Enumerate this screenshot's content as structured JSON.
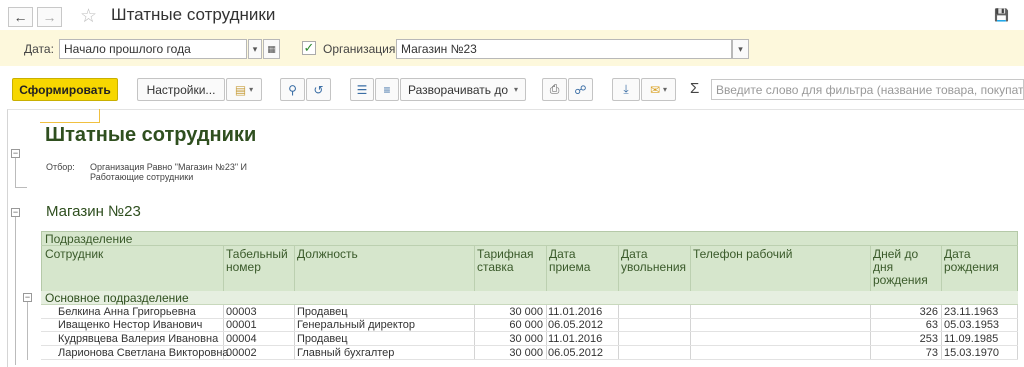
{
  "window": {
    "title": "Штатные сотрудники"
  },
  "params": {
    "date_label": "Дата:",
    "date_value": "Начало прошлого года",
    "org_label": "Организация:",
    "org_value": "Магазин №23"
  },
  "toolbar": {
    "generate_label": "Сформировать",
    "settings_label": "Настройки...",
    "expand_label": "Разворачивать до",
    "filter_placeholder": "Введите слово для фильтра (название товара, покупателя...)"
  },
  "report": {
    "title": "Штатные сотрудники",
    "filter_label": "Отбор:",
    "filter_text_line1": "Организация Равно \"Магазин №23\" И",
    "filter_text_line2": "Работающие сотрудники",
    "org_heading": "Магазин №23",
    "group_header": "Подразделение",
    "columns": {
      "employee": "Сотрудник",
      "tab_no_1": "Табельный",
      "tab_no_2": "номер",
      "position": "Должность",
      "rate_1": "Тарифная",
      "rate_2": "ставка",
      "hire_1": "Дата",
      "hire_2": "приема",
      "fire_1": "Дата",
      "fire_2": "увольнения",
      "phone": "Телефон рабочий",
      "days_1": "Дней до",
      "days_2": "дня",
      "days_3": "рождения",
      "birth_1": "Дата",
      "birth_2": "рождения"
    },
    "group_name": "Основное подразделение",
    "rows": [
      {
        "name": "Белкина Анна Григорьевна",
        "tab": "00003",
        "position": "Продавец",
        "rate": "30 000",
        "hire": "11.01.2016",
        "fire": "",
        "phone": "",
        "days": "326",
        "birth": "23.11.1963"
      },
      {
        "name": "Иващенко Нестор Иванович",
        "tab": "00001",
        "position": "Генеральный директор",
        "rate": "60 000",
        "hire": "06.05.2012",
        "fire": "",
        "phone": "",
        "days": "63",
        "birth": "05.03.1953"
      },
      {
        "name": "Кудрявцева Валерия Ивановна",
        "tab": "00004",
        "position": "Продавец",
        "rate": "30 000",
        "hire": "11.01.2016",
        "fire": "",
        "phone": "",
        "days": "253",
        "birth": "11.09.1985"
      },
      {
        "name": "Ларионова Светлана Викторовна",
        "tab": "00002",
        "position": "Главный бухгалтер",
        "rate": "30 000",
        "hire": "06.05.2012",
        "fire": "",
        "phone": "",
        "days": "73",
        "birth": "15.03.1970"
      }
    ]
  },
  "colors": {
    "accent_yellow": "#f7d700",
    "header_green": "#d6e6cc",
    "title_green": "#2f4f1f"
  }
}
